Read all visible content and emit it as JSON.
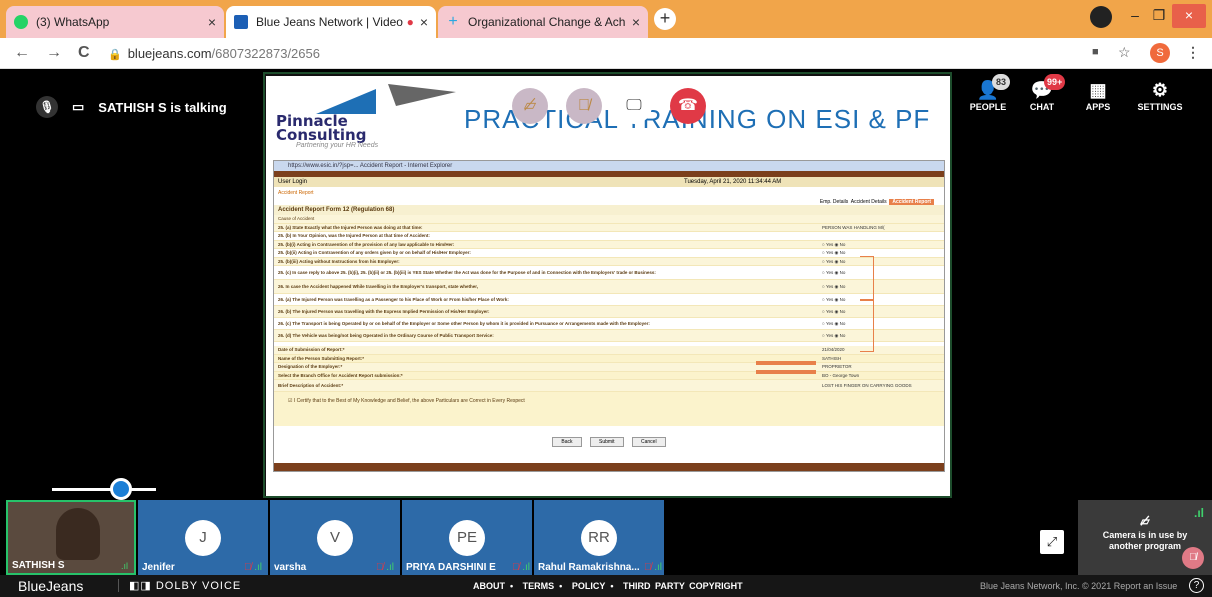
{
  "browser": {
    "tabs": [
      {
        "title": "(3) WhatsApp",
        "icon": "whatsapp-icon",
        "color": "#25d366",
        "close": "×"
      },
      {
        "title": "Blue Jeans Network | Video C",
        "icon": "bluejeans-icon",
        "color": "#1c5fb5",
        "close": "×",
        "recording": "●"
      },
      {
        "title": "Organizational Change & Achiev",
        "icon": "plus-cross-icon",
        "color": "#2aa8e0",
        "close": "×"
      }
    ],
    "new_tab": "+",
    "url_host": "bluejeans.com",
    "url_path": "/6807322873/2656",
    "nav": {
      "back": "←",
      "forward": "→",
      "reload": "C"
    },
    "profile_initial": "S"
  },
  "meeting": {
    "talking_text": "SATHISH S is talking",
    "right_icons": [
      {
        "label": "PEOPLE",
        "badge": "83",
        "glyph": "👤"
      },
      {
        "label": "CHAT",
        "badge": "99+",
        "glyph": "💬"
      },
      {
        "label": "APPS",
        "badge": "",
        "glyph": "▦"
      },
      {
        "label": "SETTINGS",
        "badge": "",
        "glyph": "⚙"
      }
    ]
  },
  "slide": {
    "logo_name_1": "Pinnacle",
    "logo_name_2": "Consulting",
    "logo_tagline": "Partnering your HR Needs",
    "title": "PRACTICAL TRAINING ON ESI & PF",
    "window_title": "https://www.esic.in/?jsp=... Accident Report - Internet Explorer",
    "user_login": "User Login",
    "date_time": "Tuesday, April 21, 2020 11:34:44 AM",
    "crumb": "Accident Report",
    "tabs_right": [
      "Emp. Details",
      "Accident Details",
      "Accident Report"
    ],
    "form_title": "Accident Report Form 12 (Regulation 68)",
    "section": "Cause of Accident",
    "rows": [
      {
        "q": "25. (a) State Exactly what the Injured Person was doing at that time:",
        "a": "PERSON WAS HANDLING M/("
      },
      {
        "q": "25. (b) In Your Opinion, was the Injured Person at that time of Accident:",
        "a": ""
      },
      {
        "q": "25. (b)(i) Acting in Contravention of the provision of any law applicable to Him/Her:",
        "a": "○ Yes ◉ No"
      },
      {
        "q": "25. (b)(ii) Acting in Contravention of any orders given by or on behalf of His/Her Employer:",
        "a": "○ Yes ◉ No"
      },
      {
        "q": "25. (b)(iii) Acting without Instructions from his Employer:",
        "a": "○ Yes ◉ No"
      },
      {
        "q": "25. (c) In case reply to above 25. (b)(i), 25. (b)(ii) or 25. (b)(iii) is YES State Whether the Act was done for the Purpose of and in Connection with the Employers' trade or Business:",
        "a": "○ Yes ◉ No"
      },
      {
        "q": "26. In case the Accident happened While travelling in the Employer's transport, state whether,",
        "a": "○ Yes ◉ No"
      },
      {
        "q": "26. (a) The Injured Person was travelling as a Passenger to his Place of Work or From his/her Place of Work:",
        "a": "○ Yes ◉ No"
      },
      {
        "q": "26. (b) The Injured Person was travelling with the Express Implied Permission of His/Her Employer:",
        "a": "○ Yes ◉ No"
      },
      {
        "q": "26. (c) The Transport is being Operated by or on behalf of the Employer or Some other Person by whom it is provided in Pursuance or Arrangements made with the Employer:",
        "a": "○ Yes ◉ No"
      },
      {
        "q": "26. (d) The Vehicle was being/not being Operated in the Ordinary Course of Public Transport Service:",
        "a": "○ Yes ◉ No"
      }
    ],
    "rows2": [
      {
        "q": "Date of Submission of Report:*",
        "a": "21/04/2020"
      },
      {
        "q": "Name of the Person Submitting Report:*",
        "a": "SATHISH"
      },
      {
        "q": "Designation of the Employer:*",
        "a": "PROPRIETOR"
      },
      {
        "q": "Select the Branch Office for Accident Report submission:*",
        "a": "BO - George Town"
      },
      {
        "q": "Brief Description of Accident:*",
        "a": "LOST HIS FINGER ON CARRYING GOODS"
      }
    ],
    "certify": "I Certify that to the Best of My Knowledge and Belief, the above Particulars are Correct in Every Respect",
    "buttons": [
      "Back",
      "Submit",
      "Cancel"
    ]
  },
  "participants": [
    {
      "name": "SATHISH S",
      "initials": ""
    },
    {
      "name": "Jenifer",
      "initials": "J"
    },
    {
      "name": "varsha",
      "initials": "V"
    },
    {
      "name": "PRIYA DARSHINI E",
      "initials": "PE"
    },
    {
      "name": "Rahul Ramakrishna...",
      "initials": "RR"
    }
  ],
  "camera_panel": {
    "text": "Camera is in use by another program"
  },
  "footer": {
    "brand": "BlueJeans",
    "dolby": "DOLBY VOICE",
    "links": [
      "ABOUT",
      "TERMS",
      "POLICY",
      "THIRD PARTY COPYRIGHT"
    ],
    "copyright": "Blue Jeans Network, Inc. © 2021   Report an Issue",
    "help": "?"
  },
  "colors": {
    "tabstrip": "#f1a54a",
    "accent": "#1c7fd6",
    "danger": "#e03946",
    "tile": "#2d6aa8"
  }
}
